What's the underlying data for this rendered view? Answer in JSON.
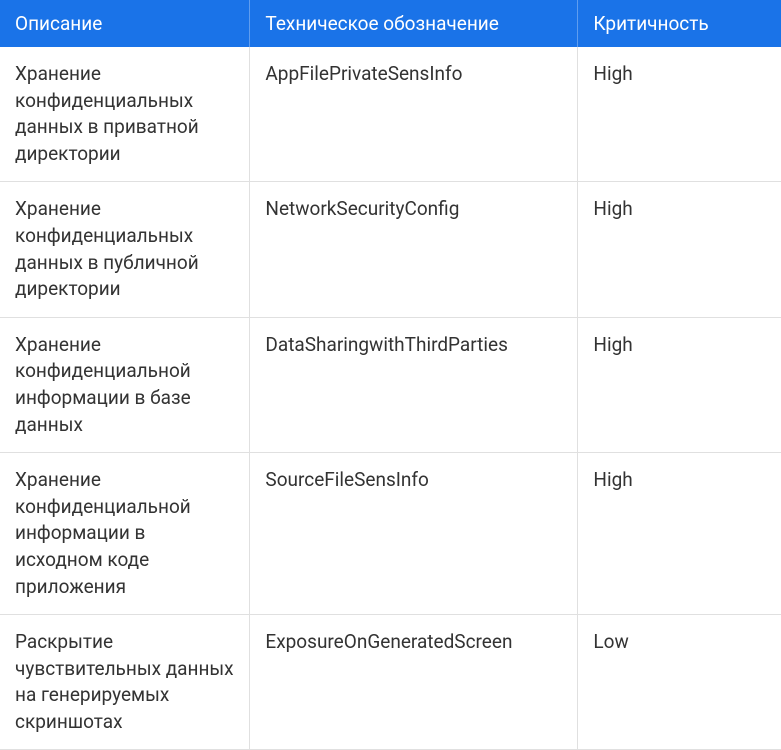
{
  "table": {
    "headers": {
      "description": "Описание",
      "technical": "Техническое обозначение",
      "criticality": "Критичность"
    },
    "rows": [
      {
        "description": "Хранение конфиденциальных данных в приватной директории",
        "technical": "AppFilePrivateSensInfo",
        "criticality": "High"
      },
      {
        "description": "Хранение конфиденциальных данных в публичной директории",
        "technical": "NetworkSecurityConfig",
        "criticality": "High"
      },
      {
        "description": "Хранение конфиденциальной информации в базе данных",
        "technical": "DataSharingwithThirdParties",
        "criticality": "High"
      },
      {
        "description": "Хранение конфиденциальной информации в исходном коде приложения",
        "technical": "SourceFileSensInfo",
        "criticality": "High"
      },
      {
        "description": "Раскрытие чувствительных данных на генерируемых скриншотах",
        "technical": "ExposureOnGeneratedScreen",
        "criticality": "Low"
      }
    ]
  }
}
